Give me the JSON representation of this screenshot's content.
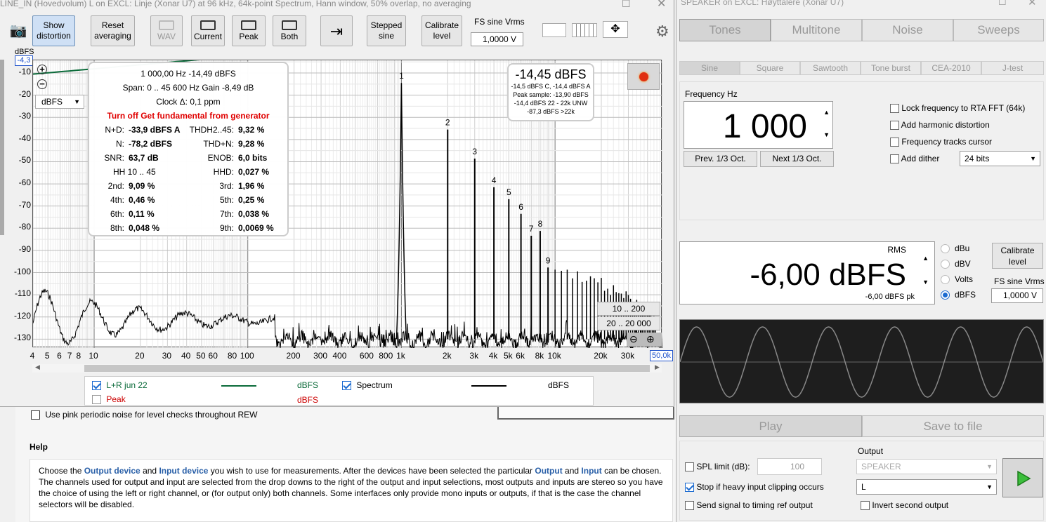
{
  "rta": {
    "title": "LINE_IN (Hovedvolum) L on EXCL: Linje (Xonar U7) at 96 kHz, 64k-point Spectrum, Hann window, 50% overlap, no averaging",
    "toolbar": {
      "show_distortion": "Show distortion",
      "reset_averaging": "Reset averaging",
      "wav": "WAV",
      "current": "Current",
      "peak": "Peak",
      "both": "Both",
      "stepped_sine": "Stepped sine",
      "calibrate_level": "Calibrate level",
      "fs_label": "FS sine Vrms",
      "fs_value": "1,0000 V"
    },
    "y_unit": "dBFS",
    "y_top_value": "-4,3",
    "y_selector": "dBFS",
    "x_end_value": "50,0k",
    "distortion": {
      "line1": "1 000,00 Hz  -14,49 dBFS",
      "line2": "Span: 0 .. 45 600 Hz   Gain -8,49 dB",
      "line3": "Clock Δ: 0,1 ppm",
      "warning": "Turn off Get fundamental from generator",
      "rows": [
        [
          "N+D:",
          "-33,9 dBFS A",
          "THDH2..45:",
          "9,32 %"
        ],
        [
          "N:",
          "-78,2 dBFS",
          "THD+N:",
          "9,28 %"
        ],
        [
          "SNR:",
          "63,7 dB",
          "ENOB:",
          "6,0 bits"
        ],
        [
          "HH 10 .. 45",
          "",
          "HHD:",
          "0,027 %"
        ],
        [
          "2nd:",
          "9,09 %",
          "3rd:",
          "1,96 %"
        ],
        [
          "4th:",
          "0,46 %",
          "5th:",
          "0,25 %"
        ],
        [
          "6th:",
          "0,11 %",
          "7th:",
          "0,038 %"
        ],
        [
          "8th:",
          "0,048 %",
          "9th:",
          "0,0069 %"
        ]
      ]
    },
    "level_box": {
      "big": "-14,45 dBFS",
      "lines": [
        "-14,5 dBFS C, -14,4 dBFS A",
        "Peak sample: -13,90 dBFS",
        "-14,4 dBFS 22 - 22k UNW",
        "-87,3 dBFS >22k"
      ]
    },
    "range_buttons": [
      "10 .. 200",
      "20 .. 20 000"
    ],
    "legend": [
      {
        "label": "L+R jun 22",
        "unit": "dBFS",
        "color": "#0b6b3a",
        "checked": true
      },
      {
        "label": "Spectrum",
        "unit": "dBFS",
        "color": "#000000",
        "checked": true
      },
      {
        "label": "Peak",
        "unit": "dBFS",
        "color": "#cc0000",
        "checked": false
      }
    ]
  },
  "chart_data": {
    "type": "line",
    "x_scale": "log",
    "xlim": [
      4,
      50000
    ],
    "ylim": [
      -134,
      -4.3
    ],
    "yticks": [
      -10,
      -20,
      -30,
      -40,
      -50,
      -60,
      -70,
      -80,
      -90,
      -100,
      -110,
      -120,
      -130
    ],
    "xticks": [
      {
        "v": 4,
        "l": "4"
      },
      {
        "v": 5,
        "l": "5"
      },
      {
        "v": 6,
        "l": "6"
      },
      {
        "v": 7,
        "l": "7"
      },
      {
        "v": 8,
        "l": "8"
      },
      {
        "v": 10,
        "l": "10"
      },
      {
        "v": 20,
        "l": "20"
      },
      {
        "v": 30,
        "l": "30"
      },
      {
        "v": 40,
        "l": "40"
      },
      {
        "v": 50,
        "l": "50"
      },
      {
        "v": 60,
        "l": "60"
      },
      {
        "v": 80,
        "l": "80"
      },
      {
        "v": 100,
        "l": "100"
      },
      {
        "v": 200,
        "l": "200"
      },
      {
        "v": 300,
        "l": "300"
      },
      {
        "v": 400,
        "l": "400"
      },
      {
        "v": 600,
        "l": "600"
      },
      {
        "v": 800,
        "l": "800"
      },
      {
        "v": 1000,
        "l": "1k"
      },
      {
        "v": 2000,
        "l": "2k"
      },
      {
        "v": 3000,
        "l": "3k"
      },
      {
        "v": 4000,
        "l": "4k"
      },
      {
        "v": 5000,
        "l": "5k"
      },
      {
        "v": 6000,
        "l": "6k"
      },
      {
        "v": 8000,
        "l": "8k"
      },
      {
        "v": 10000,
        "l": "10k"
      },
      {
        "v": 20000,
        "l": "20k"
      },
      {
        "v": 30000,
        "l": "30k"
      }
    ],
    "series": [
      {
        "name": "Spectrum",
        "harmonics": [
          {
            "n": "1",
            "f": 1000,
            "db": -14.5
          },
          {
            "n": "2",
            "f": 2000,
            "db": -35.5
          },
          {
            "n": "3",
            "f": 3000,
            "db": -48.6
          },
          {
            "n": "4",
            "f": 4000,
            "db": -61.5
          },
          {
            "n": "5",
            "f": 5000,
            "db": -66.9
          },
          {
            "n": "6",
            "f": 6000,
            "db": -73.5
          },
          {
            "n": "7",
            "f": 7000,
            "db": -83.4
          },
          {
            "n": "8",
            "f": 8000,
            "db": -81.2
          },
          {
            "n": "9",
            "f": 9000,
            "db": -97.7
          }
        ],
        "noise_floor": -130
      },
      {
        "name": "L+R jun 22"
      }
    ]
  },
  "pink_noise_label": "Use pink periodic noise for level checks throughout REW",
  "help": {
    "title": "Help",
    "text_parts": [
      "Choose the ",
      "Output device",
      " and ",
      "Input device",
      " you wish to use for measurements. After the devices have been selected the particular ",
      "Output",
      " and ",
      "Input",
      " can be chosen. The channels used for output and input are selected from the drop downs to the right of the output and input selections, most outputs and inputs are stereo so you have the choice of using the left or right channel, or (for output only) both channels. Some interfaces only provide mono inputs or outputs, if that is the case the channel selectors will be disabled."
    ]
  },
  "speaker": {
    "title": "SPEAKER on EXCL: Høyttalere (Xonar U7)",
    "tabs": [
      "Tones",
      "Multitone",
      "Noise",
      "Sweeps"
    ],
    "subtabs": [
      "Sine",
      "Square",
      "Sawtooth",
      "Tone burst",
      "CEA-2010",
      "J-test"
    ],
    "freq_label": "Frequency Hz",
    "freq_value": "1 000",
    "prev_oct": "Prev. 1/3 Oct.",
    "next_oct": "Next 1/3 Oct.",
    "options": [
      "Lock frequency to RTA FFT (64k)",
      "Add harmonic distortion",
      "Frequency tracks cursor",
      "Add dither"
    ],
    "dither_bits": "24 bits",
    "rms_label": "RMS",
    "rms_value": "-6,00 dBFS",
    "rms_sub": "-6,00 dBFS pk",
    "units": [
      "dBu",
      "dBV",
      "Volts",
      "dBFS"
    ],
    "units_selected": "dBFS",
    "calibrate": "Calibrate level",
    "fs_label": "FS sine Vrms",
    "fs_value": "1,0000 V",
    "play": "Play",
    "save": "Save to file",
    "spl_label": "SPL limit (dB):",
    "spl_value": "100",
    "stop_label": "Stop if heavy input clipping occurs",
    "timing_label": "Send signal to timing ref output",
    "output_label": "Output",
    "output_device": "SPEAKER",
    "output_channel": "L",
    "invert_label": "Invert second output"
  }
}
